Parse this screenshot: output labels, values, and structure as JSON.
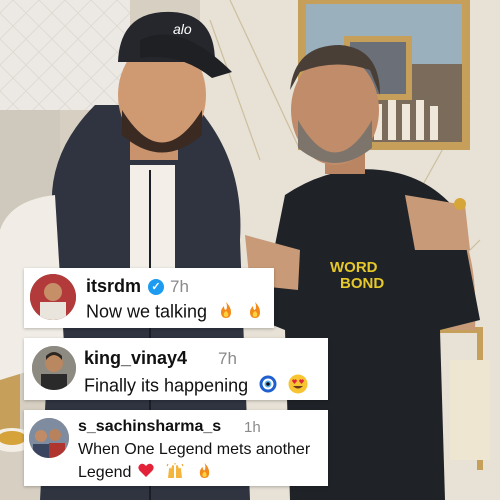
{
  "comments": [
    {
      "username": "itsrdm",
      "verified": true,
      "time": "7h",
      "text": "Now we talking",
      "emojis": [
        "fire-emoji",
        "fire-emoji"
      ]
    },
    {
      "username": "king_vinay4",
      "verified": false,
      "time": "7h",
      "text": "Finally its happening",
      "emojis": [
        "nazar-amulet-emoji",
        "heart-eyes-emoji"
      ]
    },
    {
      "username": "s_sachinsharma_s",
      "verified": false,
      "time": "1h",
      "text_line1": "When One Legend mets another",
      "text_line2": "Legend",
      "emojis": [
        "red-heart-emoji",
        "raised-hands-emoji",
        "fire-emoji"
      ]
    }
  ],
  "photo": {
    "cap_logo": "alo",
    "shirt_print_line1": "WORD",
    "shirt_print_line2": "BOND"
  },
  "colors": {
    "verified_badge": "#1d9bf0",
    "timestamp": "#8a8a8a",
    "card_background": "#ffffff",
    "shirt": "#1f2328",
    "shirt_print": "#e6c82a"
  }
}
